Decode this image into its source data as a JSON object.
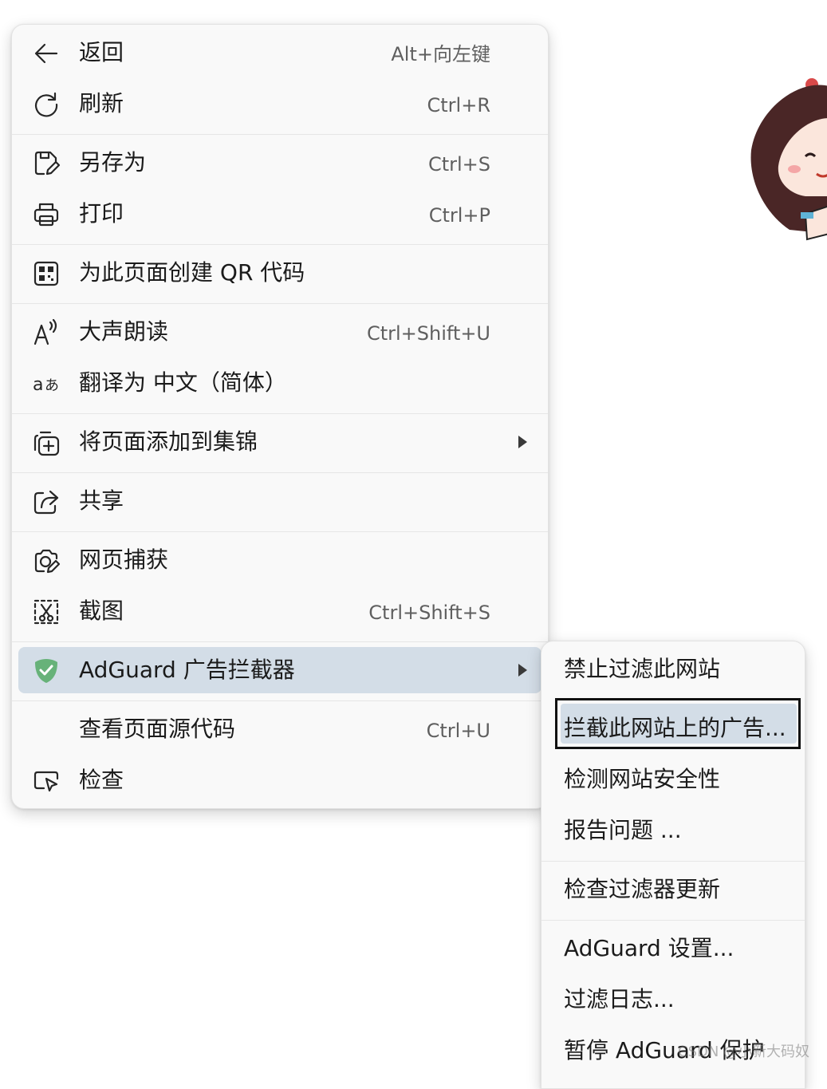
{
  "main_menu": {
    "items": [
      {
        "label": "返回",
        "shortcut": "Alt+向左键",
        "icon": "back-arrow-icon"
      },
      {
        "label": "刷新",
        "shortcut": "Ctrl+R",
        "icon": "refresh-icon"
      },
      {
        "label": "另存为",
        "shortcut": "Ctrl+S",
        "icon": "save-as-icon"
      },
      {
        "label": "打印",
        "shortcut": "Ctrl+P",
        "icon": "printer-icon"
      },
      {
        "label": "为此页面创建 QR 代码",
        "shortcut": "",
        "icon": "qr-code-icon"
      },
      {
        "label": "大声朗读",
        "shortcut": "Ctrl+Shift+U",
        "icon": "read-aloud-icon"
      },
      {
        "label": "翻译为 中文（简体）",
        "shortcut": "",
        "icon": "translate-icon"
      },
      {
        "label": "将页面添加到集锦",
        "shortcut": "",
        "icon": "collections-add-icon"
      },
      {
        "label": "共享",
        "shortcut": "",
        "icon": "share-icon"
      },
      {
        "label": "网页捕获",
        "shortcut": "",
        "icon": "web-capture-icon"
      },
      {
        "label": "截图",
        "shortcut": "Ctrl+Shift+S",
        "icon": "screenshot-icon"
      },
      {
        "label": "AdGuard 广告拦截器",
        "shortcut": "",
        "icon": "adguard-shield-icon"
      },
      {
        "label": "查看页面源代码",
        "shortcut": "Ctrl+U",
        "icon": ""
      },
      {
        "label": "检查",
        "shortcut": "",
        "icon": "inspect-icon"
      }
    ],
    "highlighted_item": "AdGuard 广告拦截器"
  },
  "submenu": {
    "items": [
      {
        "label": "禁止过滤此网站"
      },
      {
        "label": "拦截此网站上的广告..."
      },
      {
        "label": "检测网站安全性"
      },
      {
        "label": "报告问题 ..."
      },
      {
        "label": "检查过滤器更新"
      },
      {
        "label": "AdGuard 设置..."
      },
      {
        "label": "过滤日志..."
      },
      {
        "label": "暂停 AdGuard 保护"
      }
    ],
    "selected_item": "拦截此网站上的广告..."
  },
  "watermark": "CSDN @小新大码奴",
  "colors": {
    "menu_bg": "#f9f9f9",
    "highlight": "#d3dde7",
    "adguard_green": "#67b279",
    "shortcut_text": "#5f5f5f"
  }
}
